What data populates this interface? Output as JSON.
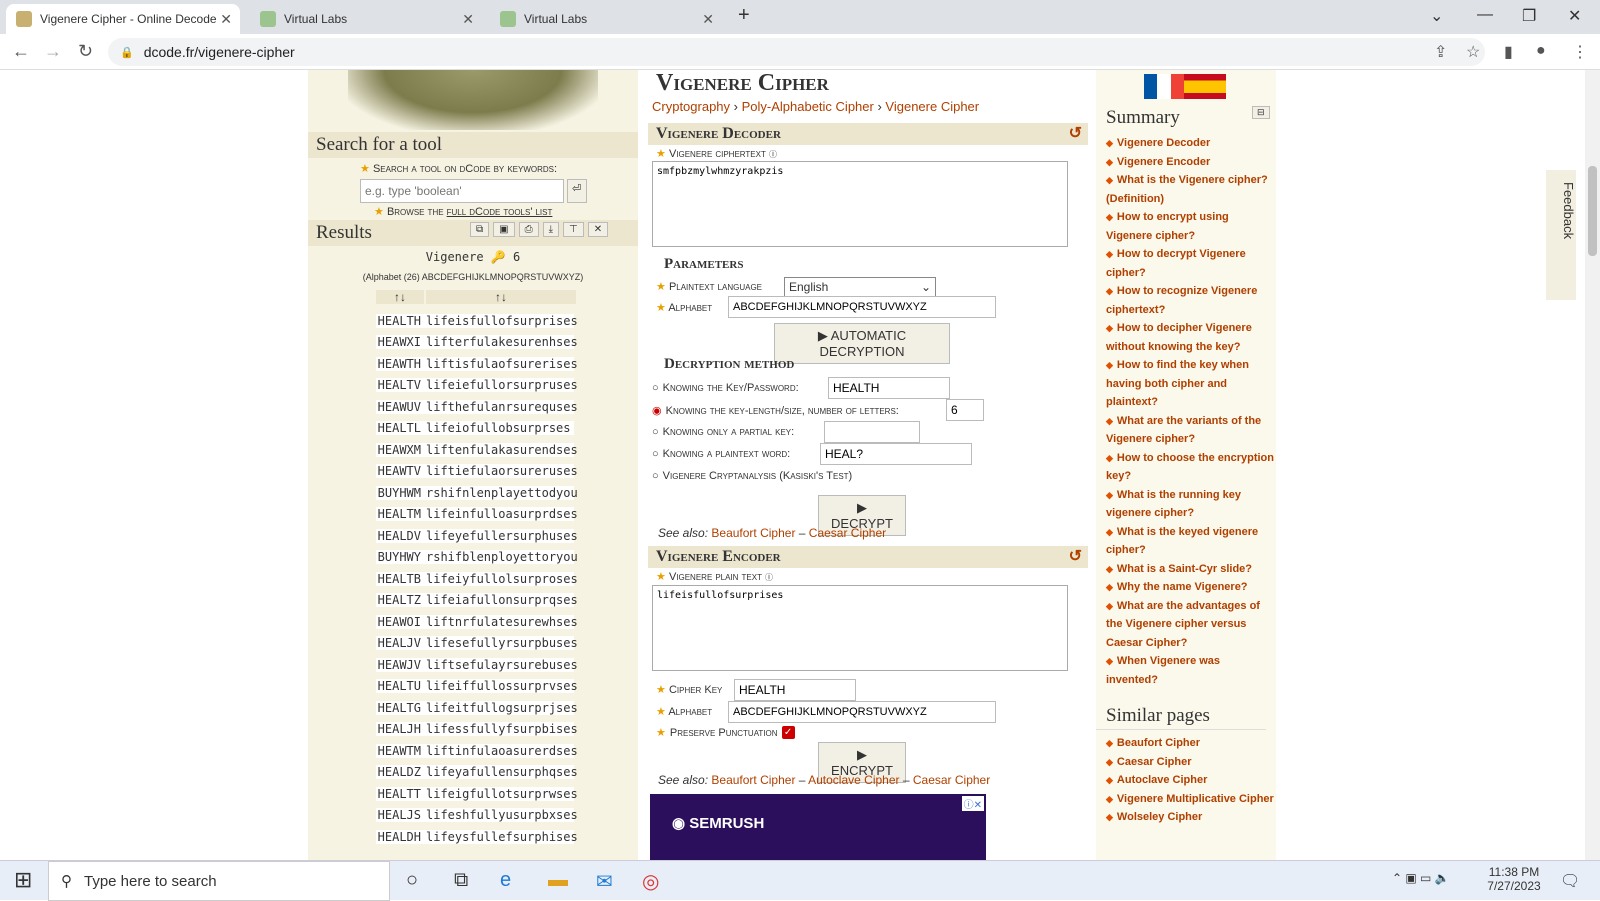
{
  "browser": {
    "tabs": [
      {
        "title": "Vigenere Cipher - Online Decode",
        "active": true
      },
      {
        "title": "Virtual Labs",
        "active": false
      },
      {
        "title": "Virtual Labs",
        "active": false
      }
    ],
    "new_tab": "+",
    "url": "dcode.fr/vigenere-cipher"
  },
  "left": {
    "search_title": "Search for a tool",
    "search_label": "Search a tool on dCode by keywords:",
    "search_placeholder": "e.g. type 'boolean'",
    "browse_prefix": "Browse the",
    "browse_link": "full dCode tools' list",
    "results_title": "Results",
    "result_header": "Vigenere",
    "result_header_count": "6",
    "result_alphabet": "(Alphabet (26) ABCDEFGHIJKLMNOPQRSTUVWXYZ)",
    "sort_col1": "↑↓",
    "sort_col2": "↑↓",
    "rows": [
      {
        "key": "HEALTH",
        "text": "lifeisfullofsurprises"
      },
      {
        "key": "HEAWXI",
        "text": "lifterfulakesurenhses"
      },
      {
        "key": "HEAWTH",
        "text": "liftisfulaofsurerises"
      },
      {
        "key": "HEALTV",
        "text": "lifeiefullorsurpruses"
      },
      {
        "key": "HEAWUV",
        "text": "lifthefulanrsurequses"
      },
      {
        "key": "HEALTL",
        "text": "lifeiofullobsurprses"
      },
      {
        "key": "HEAWXM",
        "text": "liftenfulakasurendses"
      },
      {
        "key": "HEAWTV",
        "text": "liftiefulaorsureruses"
      },
      {
        "key": "BUYHWM",
        "text": "rshifnlenplayettodyou"
      },
      {
        "key": "HEALTM",
        "text": "lifeinfulloasurprdses"
      },
      {
        "key": "HEALDV",
        "text": "lifeyefullersurphuses"
      },
      {
        "key": "BUYHWY",
        "text": "rshifblenployettoryou"
      },
      {
        "key": "HEALTB",
        "text": "lifeiyfullolsurproses"
      },
      {
        "key": "HEALTZ",
        "text": "lifeiafullonsurprqses"
      },
      {
        "key": "HEAWOI",
        "text": "liftnrfulatesurewhses"
      },
      {
        "key": "HEALJV",
        "text": "lifesefullyrsurpbuses"
      },
      {
        "key": "HEAWJV",
        "text": "liftsefulayrsurebuses"
      },
      {
        "key": "HEALTU",
        "text": "lifeiffullossurprvses"
      },
      {
        "key": "HEALTG",
        "text": "lifeitfullogsurprjses"
      },
      {
        "key": "HEALJH",
        "text": "lifessfullyfsurpbises"
      },
      {
        "key": "HEAWTM",
        "text": "liftinfulaoasurerdses"
      },
      {
        "key": "HEALDZ",
        "text": "lifeyafullensurphqses"
      },
      {
        "key": "HEALTT",
        "text": "lifeigfullotsurprwses"
      },
      {
        "key": "HEALJS",
        "text": "lifeshfullyusurpbxses"
      },
      {
        "key": "HEALDH",
        "text": "lifeysfullefsurphises"
      }
    ]
  },
  "center": {
    "title": "Vigenere Cipher",
    "breadcrumb": [
      "Cryptography",
      "Poly-Alphabetic Cipher",
      "Vigenere Cipher"
    ],
    "decoder": {
      "heading": "Vigenere Decoder",
      "ciphertext_label": "Vigenere ciphertext",
      "ciphertext": "smfpbzmylwhmzyrakpzis",
      "params_heading": "Parameters",
      "language_label": "Plaintext language",
      "language_value": "English",
      "alphabet_label": "Alphabet",
      "alphabet_value": "ABCDEFGHIJKLMNOPQRSTUVWXYZ",
      "auto_button": "AUTOMATIC DECRYPTION",
      "method_heading": "Decryption method",
      "method_key": "Knowing the Key/Password:",
      "method_key_value": "HEALTH",
      "method_length": "Knowing the key-length/size, number of letters:",
      "method_length_value": "6",
      "method_partial": "Knowing only a partial key:",
      "method_partial_value": "",
      "method_word": "Knowing a plaintext word:",
      "method_word_value": "HEAL?",
      "method_kasiski": "Vigenere Cryptanalysis (Kasiski's Test)",
      "decrypt_button": "DECRYPT",
      "see_also": "See also:",
      "see_also_links": [
        "Beaufort Cipher",
        "Caesar Cipher"
      ]
    },
    "encoder": {
      "heading": "Vigenere Encoder",
      "plain_label": "Vigenere plain text",
      "plain_text": "lifeisfullofsurprises",
      "key_label": "Cipher Key",
      "key_value": "HEALTH",
      "alphabet_label": "Alphabet",
      "alphabet_value": "ABCDEFGHIJKLMNOPQRSTUVWXYZ",
      "punct_label": "Preserve Punctuation",
      "encrypt_button": "ENCRYPT",
      "see_also": "See also:",
      "see_also_links": [
        "Beaufort Cipher",
        "Autoclave Cipher",
        "Caesar Cipher"
      ]
    },
    "ad_brand": "SEMRUSH"
  },
  "right": {
    "summary_title": "Summary",
    "summary_items": [
      "Vigenere Decoder",
      "Vigenere Encoder",
      "What is the Vigenere cipher? (Definition)",
      "How to encrypt using Vigenere cipher?",
      "How to decrypt Vigenere cipher?",
      "How to recognize Vigenere ciphertext?",
      "How to decipher Vigenere without knowing the key?",
      "How to find the key when having both cipher and plaintext?",
      "What are the variants of the Vigenere cipher?",
      "How to choose the encryption key?",
      "What is the running key vigenere cipher?",
      "What is the keyed vigenere cipher?",
      "What is a Saint-Cyr slide?",
      "Why the name Vigenere?",
      "What are the advantages of the Vigenere cipher versus Caesar Cipher?",
      "When Vigenere was invented?"
    ],
    "similar_title": "Similar pages",
    "similar_items": [
      "Beaufort Cipher",
      "Caesar Cipher",
      "Autoclave Cipher",
      "Vigenere Multiplicative Cipher",
      "Wolseley Cipher"
    ],
    "feedback": "Feedback"
  },
  "taskbar": {
    "search_placeholder": "Type here to search",
    "time": "11:38 PM",
    "date": "7/27/2023"
  },
  "colors": {
    "accent_link": "#b04000",
    "panel_bg": "#f7f3e3",
    "header_bg": "#ece6cf"
  }
}
